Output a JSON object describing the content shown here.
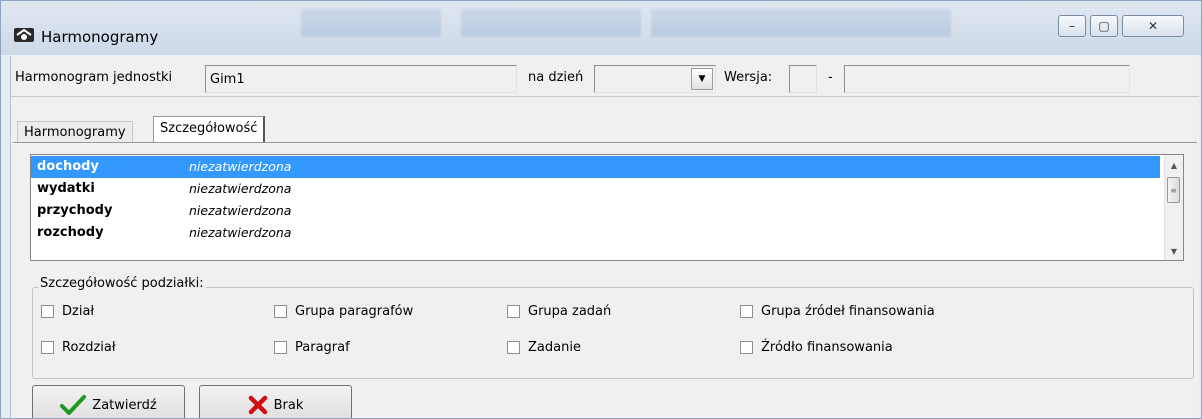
{
  "window": {
    "title": "Harmonogramy"
  },
  "window_controls": {
    "minimize": "–",
    "maximize": "▢",
    "close": "✕"
  },
  "header": {
    "unit_label": "Harmonogram jednostki",
    "unit_value": "Gim1",
    "date_label": "na dzień",
    "date_value": "",
    "version_label": "Wersja:",
    "version_value": "",
    "version_separator": "-",
    "version_desc": ""
  },
  "tabs": [
    {
      "label": "Harmonogramy",
      "active": false
    },
    {
      "label": "Szczegółowość",
      "active": true
    }
  ],
  "list": {
    "rows": [
      {
        "name": "dochody",
        "status": "niezatwierdzona",
        "selected": true
      },
      {
        "name": "wydatki",
        "status": "niezatwierdzona",
        "selected": false
      },
      {
        "name": "przychody",
        "status": "niezatwierdzona",
        "selected": false
      },
      {
        "name": "rozchody",
        "status": "niezatwierdzona",
        "selected": false
      }
    ]
  },
  "detail_group": {
    "legend": "Szczegółowość podziałki:",
    "checkboxes": [
      {
        "label": "Dział",
        "checked": false
      },
      {
        "label": "Grupa paragrafów",
        "checked": false
      },
      {
        "label": "Grupa zadań",
        "checked": false
      },
      {
        "label": "Grupa źródeł finansowania",
        "checked": false
      },
      {
        "label": "Rozdział",
        "checked": false
      },
      {
        "label": "Paragraf",
        "checked": false
      },
      {
        "label": "Zadanie",
        "checked": false
      },
      {
        "label": "Źródło finansowania",
        "checked": false
      }
    ]
  },
  "buttons": {
    "confirm": "Zatwierdź",
    "cancel": "Brak"
  },
  "colors": {
    "selection": "#3399ff",
    "confirm_icon": "#1e9a1e",
    "cancel_icon": "#d01010"
  }
}
